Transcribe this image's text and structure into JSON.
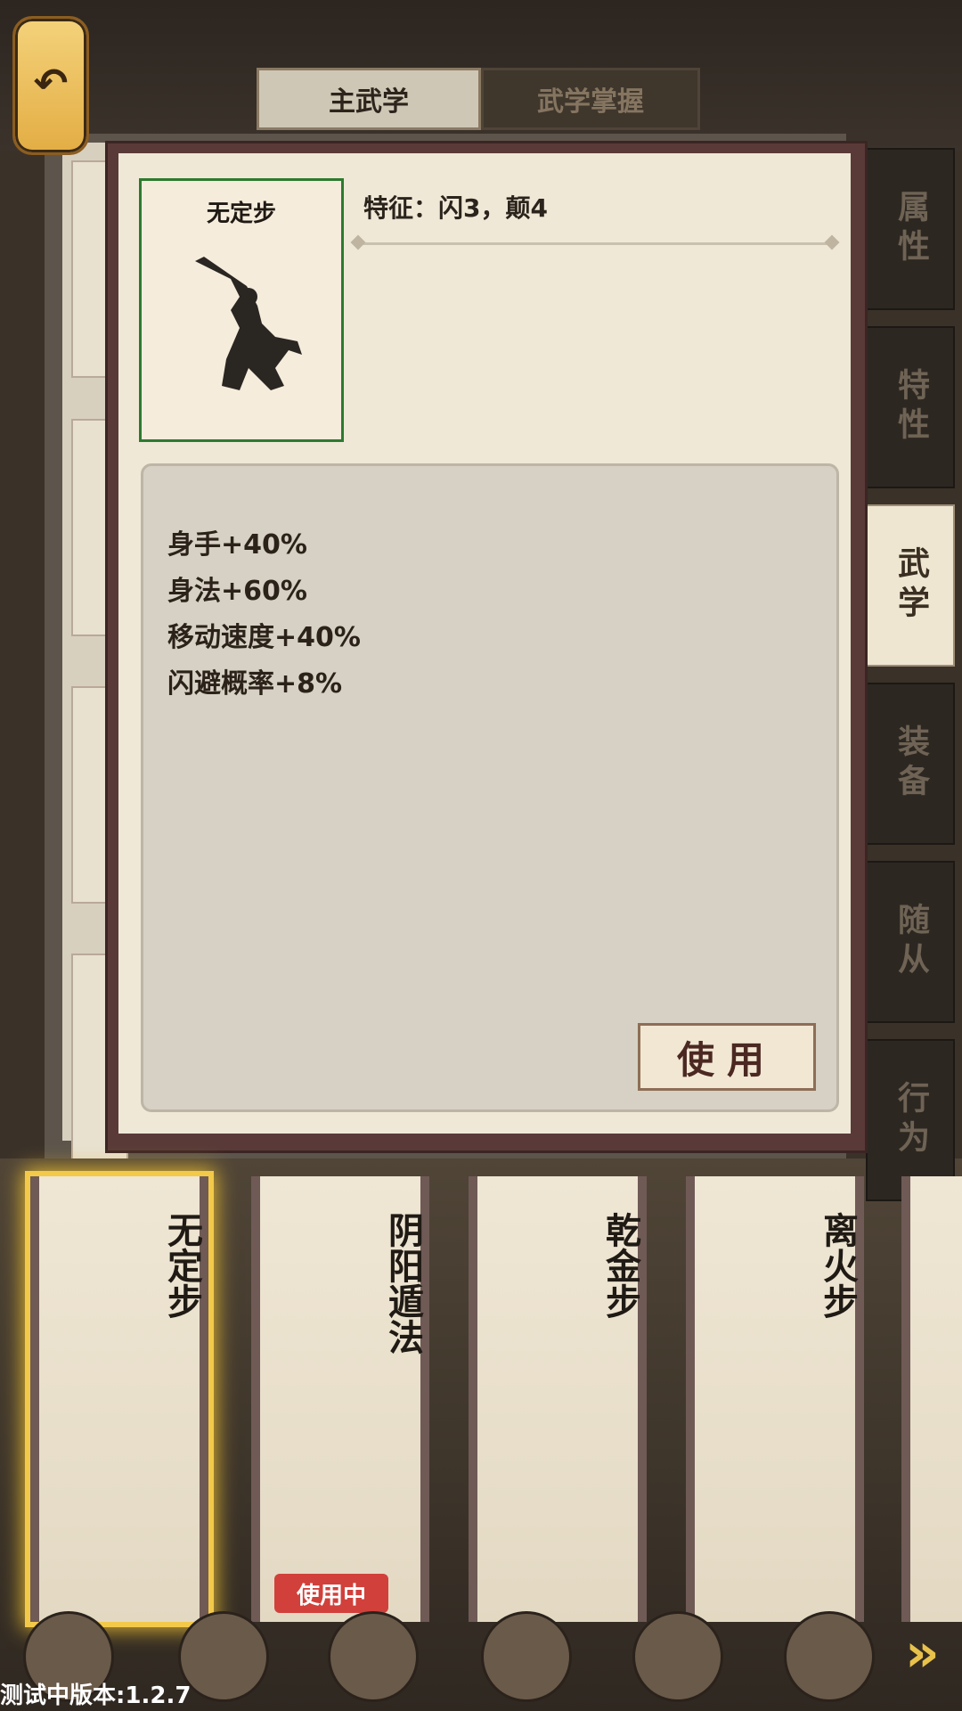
{
  "tabs": [
    {
      "label": "主武学"
    },
    {
      "label": "武学掌握"
    }
  ],
  "nav": [
    {
      "label": "属性"
    },
    {
      "label": "特性"
    },
    {
      "label": "武学"
    },
    {
      "label": "装备"
    },
    {
      "label": "随从"
    },
    {
      "label": "行为"
    }
  ],
  "detail": {
    "card_name": "无定步",
    "feature": "特征：闪3，颠4",
    "effects": [
      "身手+40%",
      "身法+60%",
      "移动速度+40%",
      "闪避概率+8%"
    ],
    "use_label": "使用"
  },
  "skills": [
    {
      "name": "无定步"
    },
    {
      "name": "阴阳遁法",
      "badge": "使用中"
    },
    {
      "name": "乾金步"
    },
    {
      "name": "离火步"
    }
  ],
  "version": "测试中版本:1.2.7",
  "colors": {
    "selected_glow": "#f3c94a",
    "badge": "#d1403b",
    "card_border": "#2d7a2f"
  }
}
